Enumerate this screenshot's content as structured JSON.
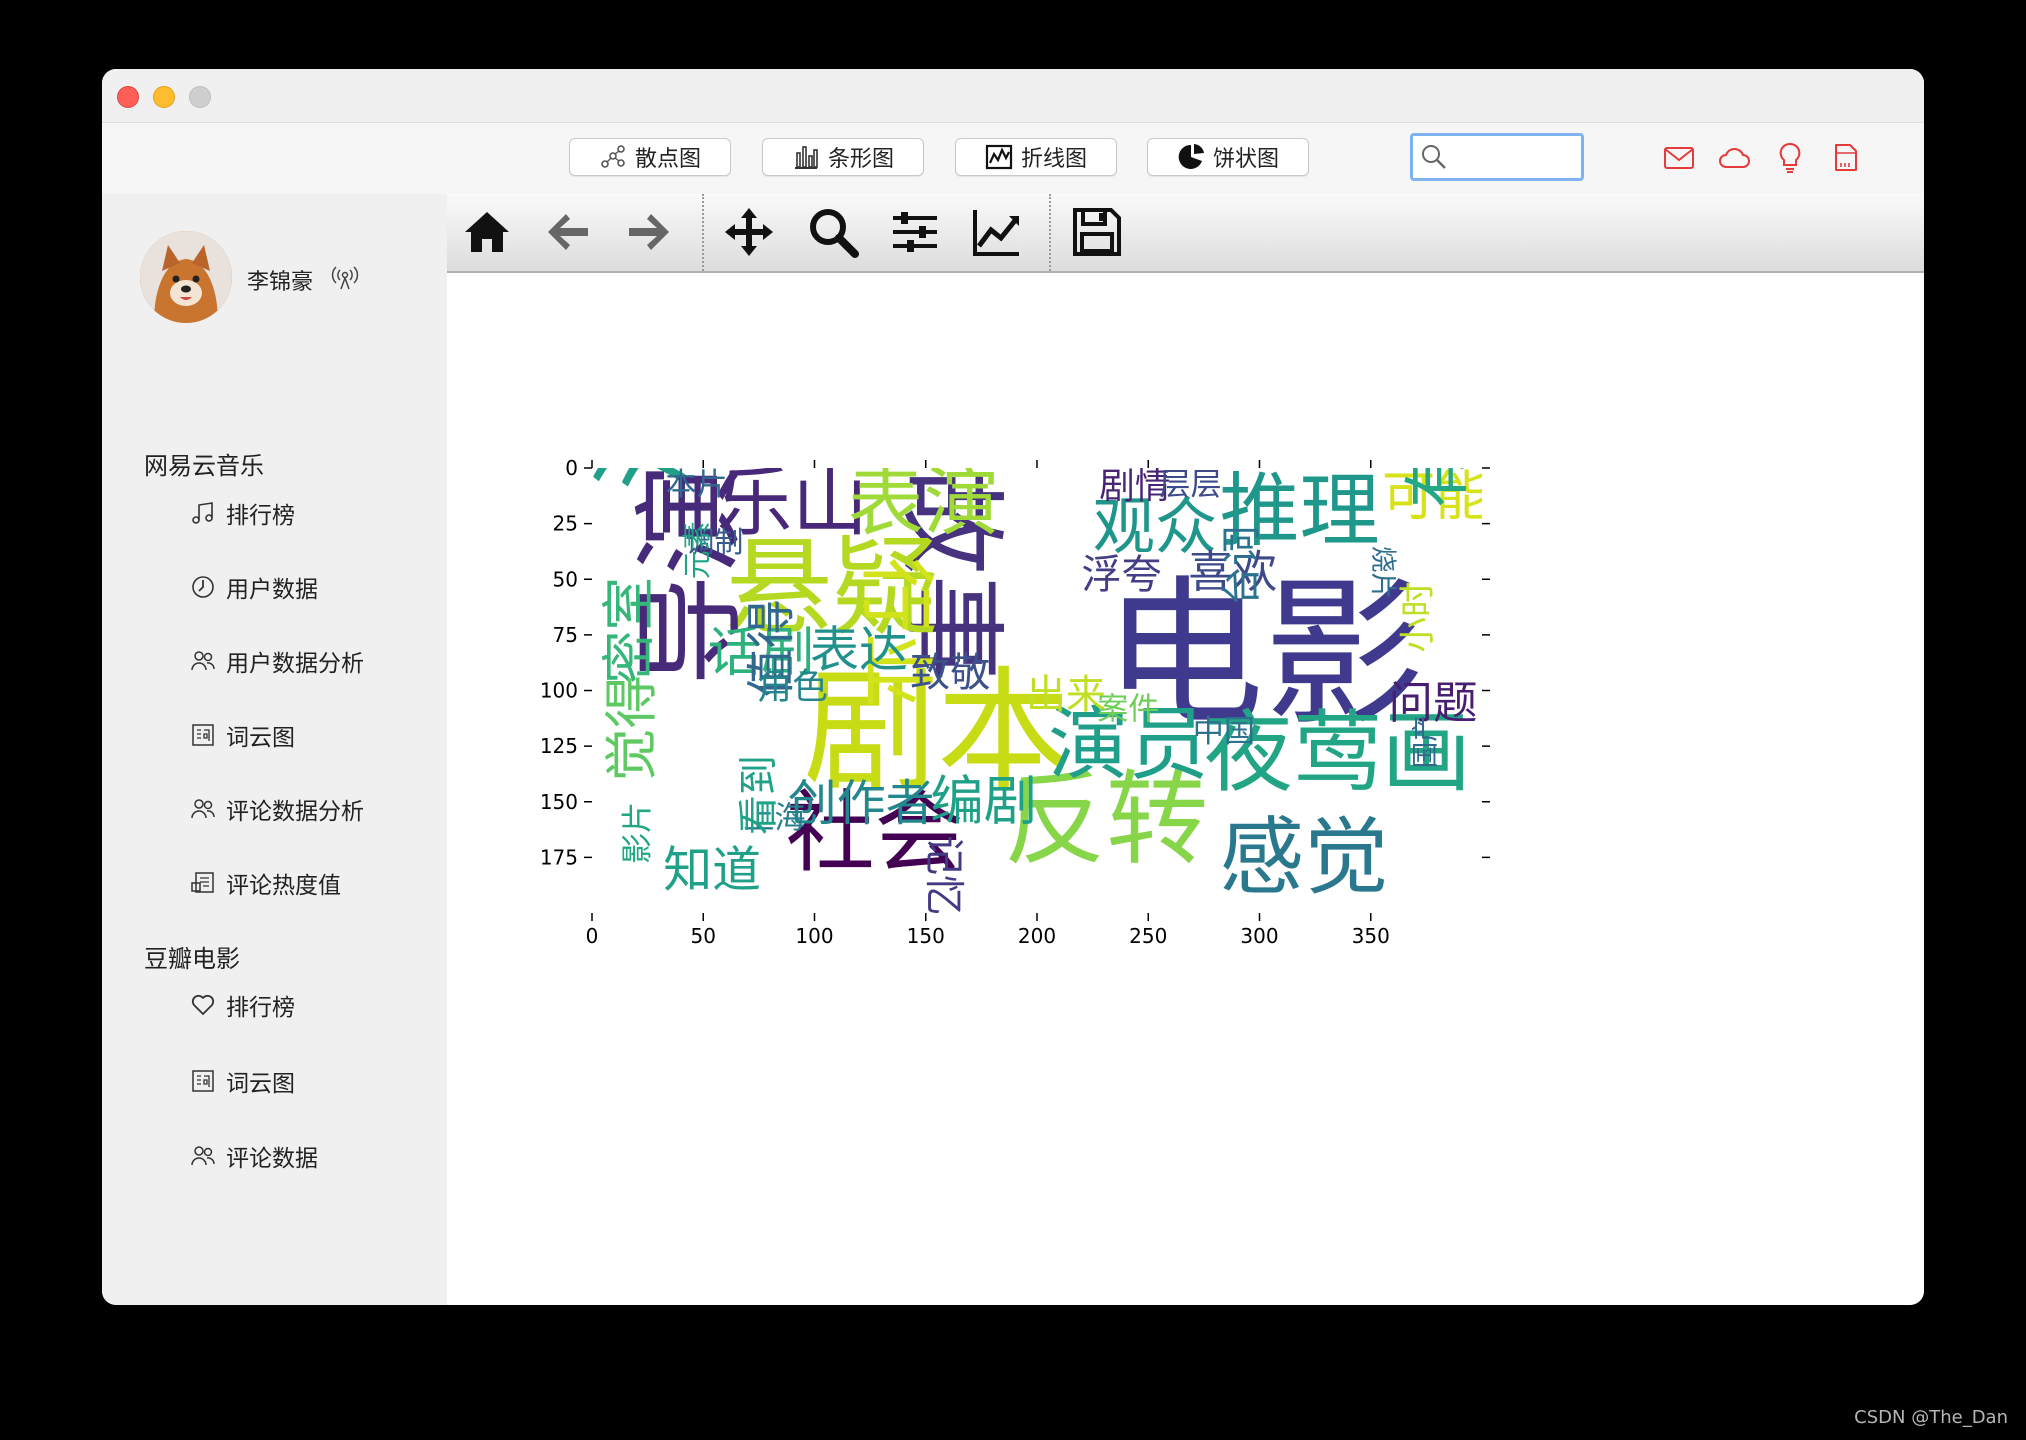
{
  "toolbar_buttons": [
    {
      "label": "散点图",
      "icon": "scatter-icon"
    },
    {
      "label": "条形图",
      "icon": "bar-chart-icon"
    },
    {
      "label": "折线图",
      "icon": "line-chart-icon"
    },
    {
      "label": "饼状图",
      "icon": "pie-chart-icon"
    }
  ],
  "search": {
    "value": ""
  },
  "user": {
    "name": "李锦豪"
  },
  "sidebar": {
    "netease_title": "网易云音乐",
    "netease_items": [
      {
        "label": "排行榜",
        "icon": "music-note-icon"
      },
      {
        "label": "用户数据",
        "icon": "clock-icon"
      },
      {
        "label": "用户数据分析",
        "icon": "users-icon"
      },
      {
        "label": "词云图",
        "icon": "word-cloud-icon"
      },
      {
        "label": "评论数据分析",
        "icon": "users-icon"
      },
      {
        "label": "评论热度值",
        "icon": "comments-icon"
      }
    ],
    "douban_title": "豆瓣电影",
    "douban_items": [
      {
        "label": "排行榜",
        "icon": "heart-icon"
      },
      {
        "label": "词云图",
        "icon": "word-cloud-icon"
      },
      {
        "label": "评论数据",
        "icon": "users-icon"
      }
    ]
  },
  "footer": "CSDN @The_Dan",
  "chart_data": {
    "type": "wordcloud",
    "x_ticks": [
      0,
      50,
      100,
      150,
      200,
      250,
      300,
      350
    ],
    "y_ticks": [
      0,
      25,
      50,
      75,
      100,
      125,
      150,
      175
    ],
    "xlim": [
      0,
      400
    ],
    "ylim": [
      200,
      0
    ],
    "words": [
      {
        "text": "电影",
        "x": 230,
        "y": 55,
        "size": 72,
        "color": "#3f3a8e",
        "rot": 0
      },
      {
        "text": "剧本",
        "x": 95,
        "y": 95,
        "size": 60,
        "color": "#c8dc16",
        "rot": 0
      },
      {
        "text": "故事",
        "x": 180,
        "y": 0,
        "size": 48,
        "color": "#46327e",
        "rot": 90
      },
      {
        "text": "悬疑",
        "x": 60,
        "y": 35,
        "size": 48,
        "color": "#b5d821",
        "rot": 0
      },
      {
        "text": "推理",
        "x": 282,
        "y": 5,
        "size": 36,
        "color": "#1f978b",
        "rot": 0
      },
      {
        "text": "反转",
        "x": 185,
        "y": 140,
        "size": 46,
        "color": "#87d549",
        "rot": 0
      },
      {
        "text": "社会",
        "x": 87,
        "y": 148,
        "size": 40,
        "color": "#440154",
        "rot": 0
      },
      {
        "text": "夜莺画",
        "x": 275,
        "y": 112,
        "size": 40,
        "color": "#21a585",
        "rot": 0
      },
      {
        "text": "感觉",
        "x": 282,
        "y": 160,
        "size": 38,
        "color": "#2a788e",
        "rot": 0
      },
      {
        "text": "演员",
        "x": 205,
        "y": 110,
        "size": 36,
        "color": "#1f9e89",
        "rot": 0
      },
      {
        "text": "没有",
        "x": 5,
        "y": 10,
        "size": 48,
        "color": "#1fa087",
        "rot": 270
      },
      {
        "text": "导演",
        "x": 25,
        "y": 98,
        "size": 50,
        "color": "#472a7a",
        "rot": 270
      },
      {
        "text": "乐山",
        "x": 56,
        "y": 2,
        "size": 34,
        "color": "#482878",
        "rot": 0
      },
      {
        "text": "表演",
        "x": 115,
        "y": 2,
        "size": 34,
        "color": "#a0da39",
        "rot": 0
      },
      {
        "text": "行业",
        "x": 150,
        "y": 40,
        "size": 34,
        "color": "#d2e21b",
        "rot": 90
      },
      {
        "text": "观众",
        "x": 225,
        "y": 15,
        "size": 28,
        "color": "#1f968b",
        "rot": 0
      },
      {
        "text": "可能",
        "x": 355,
        "y": 3,
        "size": 24,
        "color": "#d8e219",
        "rot": 0
      },
      {
        "text": "有点",
        "x": 368,
        "y": 18,
        "size": 30,
        "color": "#22a884",
        "rot": 270
      },
      {
        "text": "话剧",
        "x": 52,
        "y": 73,
        "size": 24,
        "color": "#2db27d",
        "rot": 0
      },
      {
        "text": "表达",
        "x": 98,
        "y": 73,
        "size": 22,
        "color": "#21918c",
        "rot": 0
      },
      {
        "text": "密室",
        "x": 7,
        "y": 97,
        "size": 24,
        "color": "#35b779",
        "rot": 270
      },
      {
        "text": "编剧",
        "x": 152,
        "y": 140,
        "size": 24,
        "color": "#1fa188",
        "rot": 0
      },
      {
        "text": "创作者",
        "x": 88,
        "y": 142,
        "size": 22,
        "color": "#23888e",
        "rot": 0
      },
      {
        "text": "值得",
        "x": 72,
        "y": 103,
        "size": 22,
        "color": "#31688e",
        "rot": 270
      },
      {
        "text": "觉得",
        "x": 8,
        "y": 141,
        "size": 24,
        "color": "#5ec962",
        "rot": 270
      },
      {
        "text": "知道",
        "x": 32,
        "y": 172,
        "size": 22,
        "color": "#1fa088",
        "rot": 0
      },
      {
        "text": "问题",
        "x": 358,
        "y": 98,
        "size": 20,
        "color": "#481f70",
        "rot": 0
      },
      {
        "text": "喜欢",
        "x": 268,
        "y": 39,
        "size": 20,
        "color": "#3e4989",
        "rot": 0
      },
      {
        "text": "浮夸",
        "x": 220,
        "y": 41,
        "size": 18,
        "color": "#433e85",
        "rot": 0
      },
      {
        "text": "致敬",
        "x": 143,
        "y": 85,
        "size": 18,
        "color": "#3b528b",
        "rot": 0
      },
      {
        "text": "台词",
        "x": 285,
        "y": 62,
        "size": 18,
        "color": "#2c728e",
        "rot": 270
      },
      {
        "text": "角色",
        "x": 74,
        "y": 92,
        "size": 16,
        "color": "#25858e",
        "rot": 0
      },
      {
        "text": "出来",
        "x": 195,
        "y": 95,
        "size": 18,
        "color": "#c0df25",
        "rot": 0
      },
      {
        "text": "剧情",
        "x": 228,
        "y": 2,
        "size": 16,
        "color": "#482475",
        "rot": 0
      },
      {
        "text": "层层",
        "x": 255,
        "y": 2,
        "size": 14,
        "color": "#3e4a89",
        "rot": 0
      },
      {
        "text": "本片",
        "x": 33,
        "y": 2,
        "size": 14,
        "color": "#31688e",
        "rot": 0
      },
      {
        "text": "小时",
        "x": 365,
        "y": 83,
        "size": 16,
        "color": "#bddf26",
        "rot": 270
      },
      {
        "text": "案件",
        "x": 227,
        "y": 103,
        "size": 14,
        "color": "#6ece58",
        "rot": 0
      },
      {
        "text": "中国",
        "x": 270,
        "y": 113,
        "size": 14,
        "color": "#2c728e",
        "rot": 0
      },
      {
        "text": "上海",
        "x": 68,
        "y": 152,
        "size": 14,
        "color": "#277f8e",
        "rot": 0
      },
      {
        "text": "看到",
        "x": 68,
        "y": 165,
        "size": 18,
        "color": "#1fa287",
        "rot": 270
      },
      {
        "text": "记忆",
        "x": 165,
        "y": 165,
        "size": 18,
        "color": "#443983",
        "rot": 90
      },
      {
        "text": "影片",
        "x": 15,
        "y": 178,
        "size": 14,
        "color": "#22a785",
        "rot": 270
      },
      {
        "text": "调制",
        "x": 42,
        "y": 28,
        "size": 13,
        "color": "#365c8d",
        "rot": 0
      },
      {
        "text": "元素",
        "x": 42,
        "y": 50,
        "size": 13,
        "color": "#20a486",
        "rot": 270
      },
      {
        "text": "烧片",
        "x": 360,
        "y": 35,
        "size": 12,
        "color": "#2e6e8e",
        "rot": 90
      },
      {
        "text": "国产",
        "x": 370,
        "y": 135,
        "size": 12,
        "color": "#31688e",
        "rot": 270
      }
    ]
  }
}
